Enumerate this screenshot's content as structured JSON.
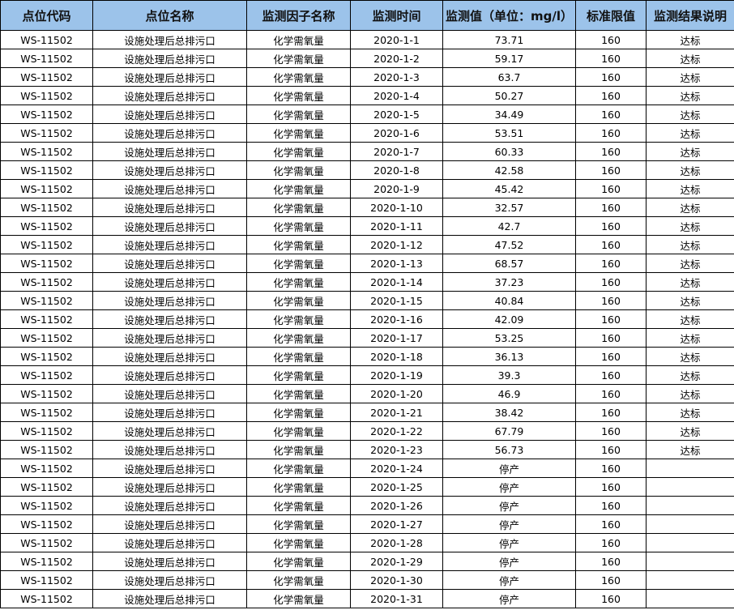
{
  "colors": {
    "header_bg": "#9cc3ea",
    "border": "#000000"
  },
  "table": {
    "headers": [
      "点位代码",
      "点位名称",
      "监测因子名称",
      "监测时间",
      "监测值（单位：mg/l）",
      "标准限值",
      "监测结果说明"
    ],
    "rows": [
      [
        "WS-11502",
        "设施处理后总排污口",
        "化学需氧量",
        "2020-1-1",
        "73.71",
        "160",
        "达标"
      ],
      [
        "WS-11502",
        "设施处理后总排污口",
        "化学需氧量",
        "2020-1-2",
        "59.17",
        "160",
        "达标"
      ],
      [
        "WS-11502",
        "设施处理后总排污口",
        "化学需氧量",
        "2020-1-3",
        "63.7",
        "160",
        "达标"
      ],
      [
        "WS-11502",
        "设施处理后总排污口",
        "化学需氧量",
        "2020-1-4",
        "50.27",
        "160",
        "达标"
      ],
      [
        "WS-11502",
        "设施处理后总排污口",
        "化学需氧量",
        "2020-1-5",
        "34.49",
        "160",
        "达标"
      ],
      [
        "WS-11502",
        "设施处理后总排污口",
        "化学需氧量",
        "2020-1-6",
        "53.51",
        "160",
        "达标"
      ],
      [
        "WS-11502",
        "设施处理后总排污口",
        "化学需氧量",
        "2020-1-7",
        "60.33",
        "160",
        "达标"
      ],
      [
        "WS-11502",
        "设施处理后总排污口",
        "化学需氧量",
        "2020-1-8",
        "42.58",
        "160",
        "达标"
      ],
      [
        "WS-11502",
        "设施处理后总排污口",
        "化学需氧量",
        "2020-1-9",
        "45.42",
        "160",
        "达标"
      ],
      [
        "WS-11502",
        "设施处理后总排污口",
        "化学需氧量",
        "2020-1-10",
        "32.57",
        "160",
        "达标"
      ],
      [
        "WS-11502",
        "设施处理后总排污口",
        "化学需氧量",
        "2020-1-11",
        "42.7",
        "160",
        "达标"
      ],
      [
        "WS-11502",
        "设施处理后总排污口",
        "化学需氧量",
        "2020-1-12",
        "47.52",
        "160",
        "达标"
      ],
      [
        "WS-11502",
        "设施处理后总排污口",
        "化学需氧量",
        "2020-1-13",
        "68.57",
        "160",
        "达标"
      ],
      [
        "WS-11502",
        "设施处理后总排污口",
        "化学需氧量",
        "2020-1-14",
        "37.23",
        "160",
        "达标"
      ],
      [
        "WS-11502",
        "设施处理后总排污口",
        "化学需氧量",
        "2020-1-15",
        "40.84",
        "160",
        "达标"
      ],
      [
        "WS-11502",
        "设施处理后总排污口",
        "化学需氧量",
        "2020-1-16",
        "42.09",
        "160",
        "达标"
      ],
      [
        "WS-11502",
        "设施处理后总排污口",
        "化学需氧量",
        "2020-1-17",
        "53.25",
        "160",
        "达标"
      ],
      [
        "WS-11502",
        "设施处理后总排污口",
        "化学需氧量",
        "2020-1-18",
        "36.13",
        "160",
        "达标"
      ],
      [
        "WS-11502",
        "设施处理后总排污口",
        "化学需氧量",
        "2020-1-19",
        "39.3",
        "160",
        "达标"
      ],
      [
        "WS-11502",
        "设施处理后总排污口",
        "化学需氧量",
        "2020-1-20",
        "46.9",
        "160",
        "达标"
      ],
      [
        "WS-11502",
        "设施处理后总排污口",
        "化学需氧量",
        "2020-1-21",
        "38.42",
        "160",
        "达标"
      ],
      [
        "WS-11502",
        "设施处理后总排污口",
        "化学需氧量",
        "2020-1-22",
        "67.79",
        "160",
        "达标"
      ],
      [
        "WS-11502",
        "设施处理后总排污口",
        "化学需氧量",
        "2020-1-23",
        "56.73",
        "160",
        "达标"
      ],
      [
        "WS-11502",
        "设施处理后总排污口",
        "化学需氧量",
        "2020-1-24",
        "停产",
        "160",
        ""
      ],
      [
        "WS-11502",
        "设施处理后总排污口",
        "化学需氧量",
        "2020-1-25",
        "停产",
        "160",
        ""
      ],
      [
        "WS-11502",
        "设施处理后总排污口",
        "化学需氧量",
        "2020-1-26",
        "停产",
        "160",
        ""
      ],
      [
        "WS-11502",
        "设施处理后总排污口",
        "化学需氧量",
        "2020-1-27",
        "停产",
        "160",
        ""
      ],
      [
        "WS-11502",
        "设施处理后总排污口",
        "化学需氧量",
        "2020-1-28",
        "停产",
        "160",
        ""
      ],
      [
        "WS-11502",
        "设施处理后总排污口",
        "化学需氧量",
        "2020-1-29",
        "停产",
        "160",
        ""
      ],
      [
        "WS-11502",
        "设施处理后总排污口",
        "化学需氧量",
        "2020-1-30",
        "停产",
        "160",
        ""
      ],
      [
        "WS-11502",
        "设施处理后总排污口",
        "化学需氧量",
        "2020-1-31",
        "停产",
        "160",
        ""
      ]
    ]
  }
}
